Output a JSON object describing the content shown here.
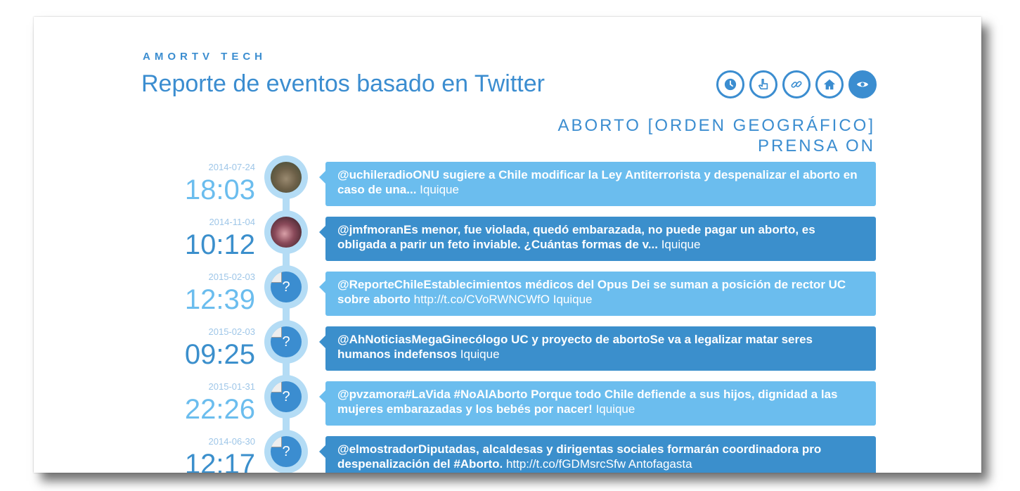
{
  "brand": "AMORTV TECH",
  "title": "Reporte de eventos basado en Twitter",
  "subtitle": {
    "line1": "ABORTO [ORDEN GEOGRÁFICO]",
    "line2": "PRENSA ON"
  },
  "nav_icons": [
    "clock-icon",
    "hand-pointer-icon",
    "link-icon",
    "home-icon",
    "eye-icon"
  ],
  "colors": {
    "accent": "#3b8dd0",
    "bubble_light": "#6bbdee",
    "bubble_dark": "#3b8fcc",
    "timeline": "#b4dcf5"
  },
  "events": [
    {
      "date": "2014-07-24",
      "time": "18:03",
      "avatar": "photo-lynx",
      "text": "@uchileradioONU sugiere a Chile modificar la Ley Antiterrorista y despenalizar el aborto en caso de una...",
      "link": "",
      "place": "Iquique"
    },
    {
      "date": "2014-11-04",
      "time": "10:12",
      "avatar": "photo-person",
      "text": "@jmfmoranEs menor, fue violada, quedó embarazada, no puede pagar un aborto, es obligada a parir un feto inviable. ¿Cuántas formas de v...",
      "link": "",
      "place": "Iquique"
    },
    {
      "date": "2015-02-03",
      "time": "12:39",
      "avatar": "?",
      "text": "@ReporteChileEstablecimientos médicos del Opus Dei se suman a posición de rector UC sobre aborto",
      "link": "http://t.co/CVoRWNCWfO",
      "place": "Iquique"
    },
    {
      "date": "2015-02-03",
      "time": "09:25",
      "avatar": "?",
      "text": "@AhNoticiasMegaGinecólogo UC y proyecto de abortoSe va a legalizar matar seres humanos indefensos",
      "link": "",
      "place": "Iquique"
    },
    {
      "date": "2015-01-31",
      "time": "22:26",
      "avatar": "?",
      "text": "@pvzamora#LaVida #NoAlAborto Porque todo Chile defiende a sus hijos, dignidad a las mujeres embarazadas y los bebés por nacer!",
      "link": "",
      "place": "Iquique"
    },
    {
      "date": "2014-06-30",
      "time": "12:17",
      "avatar": "?",
      "text": "@elmostradorDiputadas, alcaldesas y dirigentas sociales formarán coordinadora pro despenalización del #Aborto.",
      "link": "http://t.co/fGDMsrcSfw",
      "place": "Antofagasta"
    }
  ]
}
